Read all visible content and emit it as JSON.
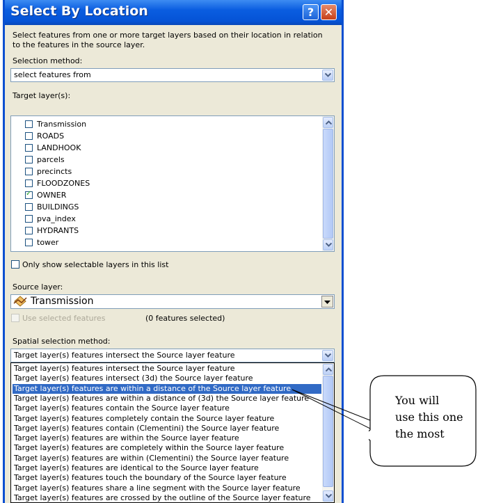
{
  "dialog": {
    "title": "Select By Location",
    "description": "Select features from one or more target layers based on their location in relation to the features in the source layer.",
    "selection_method_label": "Selection method:",
    "selection_method_value": "select features from",
    "target_layers_label": "Target layer(s):",
    "target_layers": [
      {
        "name": "Transmission",
        "checked": false
      },
      {
        "name": "ROADS",
        "checked": false
      },
      {
        "name": "LANDHOOK",
        "checked": false
      },
      {
        "name": "parcels",
        "checked": false
      },
      {
        "name": "precincts",
        "checked": false
      },
      {
        "name": "FLOODZONES",
        "checked": false
      },
      {
        "name": "OWNER",
        "checked": true
      },
      {
        "name": "BUILDINGS",
        "checked": false
      },
      {
        "name": "pva_index",
        "checked": false
      },
      {
        "name": "HYDRANTS",
        "checked": false
      },
      {
        "name": "tower",
        "checked": false
      }
    ],
    "only_selectable_label": "Only show selectable layers in this list",
    "source_layer_label": "Source layer:",
    "source_layer_value": "Transmission",
    "use_selected_label": "Use selected features",
    "features_selected": "(0 features selected)",
    "spatial_method_label": "Spatial selection method:",
    "spatial_method_value": "Target layer(s) features intersect the Source layer feature",
    "spatial_options": [
      "Target layer(s) features intersect the Source layer feature",
      "Target layer(s) features intersect (3d) the Source layer feature",
      "Target layer(s) features are within a distance of the Source layer feature",
      "Target layer(s) features are within a distance of (3d) the Source layer feature",
      "Target layer(s) features contain the Source layer feature",
      "Target layer(s) features completely contain the Source layer feature",
      "Target layer(s) features contain (Clementini) the Source layer feature",
      "Target layer(s) features are within the Source layer feature",
      "Target layer(s) features are completely within the Source layer feature",
      "Target layer(s) features are within (Clementini) the Source layer feature",
      "Target layer(s) features are identical to the Source layer feature",
      "Target layer(s) features touch the boundary of the Source layer feature",
      "Target layer(s) features share a line segment with the Source layer feature",
      "Target layer(s) features are crossed by the outline of the Source layer feature"
    ],
    "selected_option_index": 2
  },
  "callout": {
    "line1": "You will",
    "line2": "use this one",
    "line3": "the most"
  },
  "colors": {
    "titlebar": "#0553d6",
    "dialog_bg": "#ece9d8",
    "highlight": "#316ac5"
  },
  "icons": {
    "help": "question-mark",
    "close": "x-mark",
    "layer": "line-layer-symbol"
  }
}
